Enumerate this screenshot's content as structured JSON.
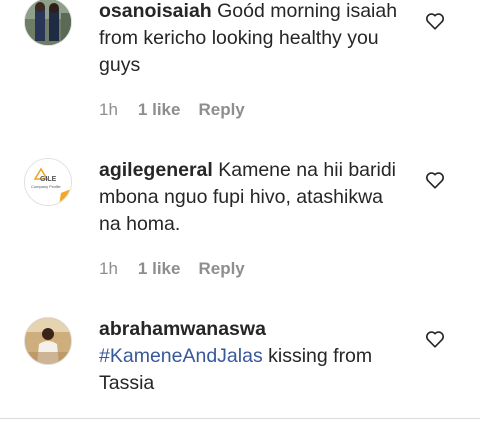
{
  "comments": [
    {
      "username": "osanoisaiah",
      "text": "Goód morning isaiah from kericho looking healthy you guys",
      "time": "1h",
      "likes": "1 like",
      "reply": "Reply"
    },
    {
      "username": "agilegeneral",
      "text": "Kamene na hii baridi mbona nguo fupi hivo, atashikwa na homa.",
      "time": "1h",
      "likes": "1 like",
      "reply": "Reply",
      "avatar_logo": "GILE",
      "avatar_caption": "Company Profile"
    },
    {
      "username": "abrahamwanaswa",
      "hashtag": "#KameneAndJalas",
      "text": "kissing from Tassia"
    }
  ],
  "icons": {
    "like": "heart-outline-icon"
  },
  "colors": {
    "text": "#262626",
    "meta": "#8e8e8e",
    "hashtag": "#385898"
  }
}
